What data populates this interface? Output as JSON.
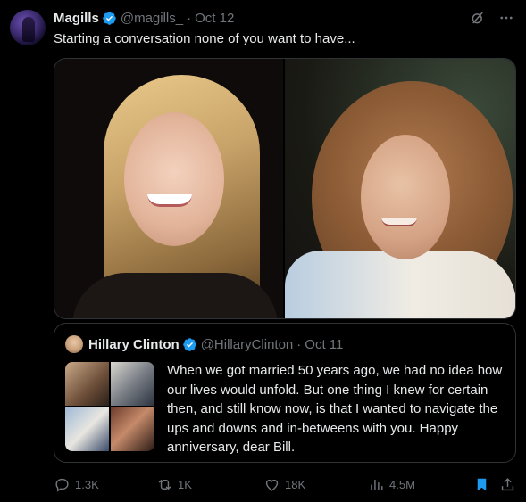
{
  "post": {
    "author_name": "Magills",
    "handle": "@magills_",
    "separator": "·",
    "date": "Oct 12",
    "text": "Starting a conversation none of you want to have..."
  },
  "icons": {
    "verified": "verified-badge-icon",
    "grok": "grok-icon",
    "more": "more-icon",
    "reply": "reply-icon",
    "repost": "repost-icon",
    "like": "like-icon",
    "views": "views-icon",
    "bookmark": "bookmark-icon",
    "share": "share-icon"
  },
  "quote": {
    "author_name": "Hillary Clinton",
    "handle": "@HillaryClinton",
    "separator": "·",
    "date": "Oct 11",
    "text": "When we got married 50 years ago, we had no idea how our lives would unfold. But one thing I knew for certain then, and still know now, is that I wanted to navigate the ups and downs and in-betweens with you. Happy anniversary, dear Bill."
  },
  "actions": {
    "replies": "1.3K",
    "reposts": "1K",
    "likes": "18K",
    "views": "4.5M"
  },
  "colors": {
    "background": "#000000",
    "text": "#e7e9ea",
    "muted": "#71767b",
    "border": "#2f3336",
    "verified": "#1d9bf0",
    "bookmark_active": "#1d9bf0"
  }
}
